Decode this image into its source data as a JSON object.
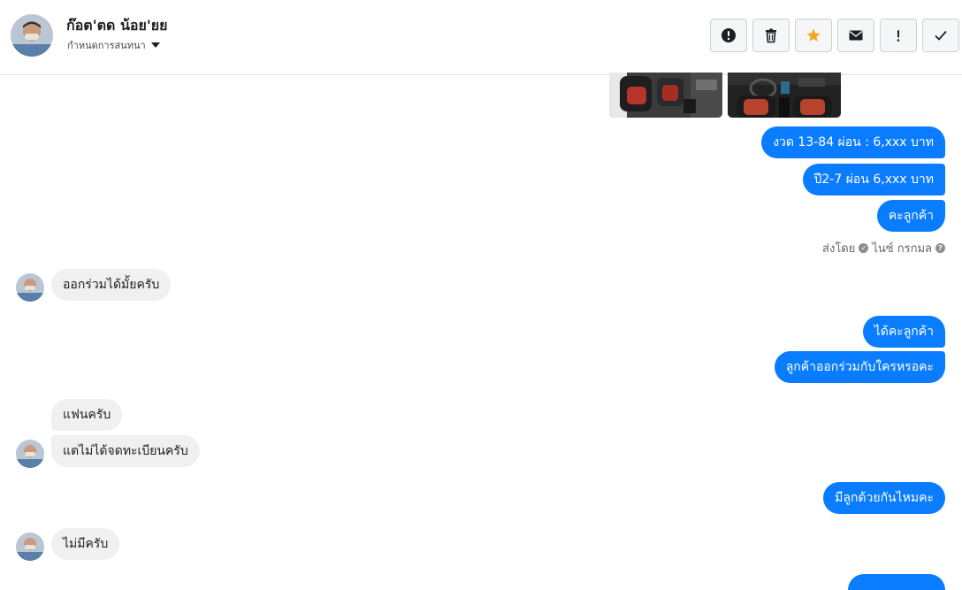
{
  "header": {
    "name": "ก๊อต'ตด น้อย'ยย",
    "subtitle": "กำหนดการสนทนา",
    "actions": [
      {
        "name": "report-button",
        "icon": "alert-circle-icon"
      },
      {
        "name": "delete-button",
        "icon": "trash-icon"
      },
      {
        "name": "star-button",
        "icon": "star-icon"
      },
      {
        "name": "mark-unread-button",
        "icon": "envelope-icon"
      },
      {
        "name": "important-button",
        "icon": "exclamation-icon"
      },
      {
        "name": "done-button",
        "icon": "check-icon"
      }
    ]
  },
  "messages": {
    "out1": "งวด 13-84  ผ่อน : 6,xxx บาท",
    "out2": "ปี2-7 ผ่อน  6,xxx บาท",
    "out3": "คะลูกค้า",
    "sent_by_label": "ส่งโดย",
    "sent_by_name": "ไนซ์ กรกมล",
    "in1": "ออกร่วมได้มั้ยครับ",
    "out4": "ได้คะลูกค้า",
    "out5": "ลูกค้าออกร่วมกับใครหรอคะ",
    "in2": "แฟนครับ",
    "in3": "แตไม่ได้จดทะเบียนครับ",
    "out6": "มีลูกด้วยกันไหมคะ",
    "in4": "ไม่มีครับ"
  },
  "colors": {
    "outgoing_bubble": "#0a7cff",
    "incoming_bubble": "#f0f0f0",
    "star": "#f5a623"
  }
}
